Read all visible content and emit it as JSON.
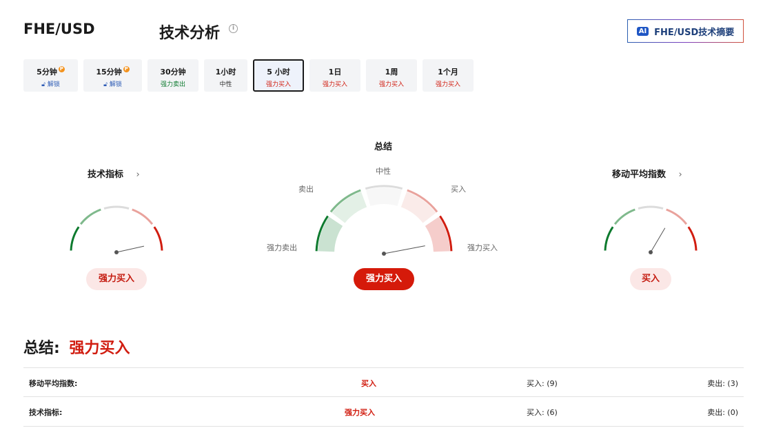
{
  "header": {
    "pair": "FHE/USD",
    "title": "技术分析",
    "info_icon": "info-circle-icon",
    "ai_badge": "AI",
    "ai_button": "FHE/USD技术摘要"
  },
  "tabs": [
    {
      "label": "5分钟",
      "sub": "解锁",
      "locked": true
    },
    {
      "label": "15分钟",
      "sub": "解锁",
      "locked": true
    },
    {
      "label": "30分钟",
      "sub": "强力卖出",
      "locked": false
    },
    {
      "label": "1小时",
      "sub": "中性",
      "locked": false
    },
    {
      "label": "5 小时",
      "sub": "强力买入",
      "locked": false,
      "active": true
    },
    {
      "label": "1日",
      "sub": "强力买入",
      "locked": false
    },
    {
      "label": "1周",
      "sub": "强力买入",
      "locked": false
    },
    {
      "label": "1个月",
      "sub": "强力买入",
      "locked": false
    }
  ],
  "gauges": {
    "technical": {
      "title": "技术指标",
      "result": "强力买入",
      "level": 0.93
    },
    "summary": {
      "title": "总结",
      "labels": {
        "neutral": "中性",
        "sell": "卖出",
        "buy": "买入",
        "strong_sell": "强力卖出",
        "strong_buy": "强力买入"
      },
      "result": "强力买入",
      "level": 0.94
    },
    "moving_avg": {
      "title": "移动平均指数",
      "result": "买入",
      "level": 0.67
    }
  },
  "summary": {
    "label": "总结:",
    "value": "强力买入",
    "rows": [
      {
        "name": "移动平均指数:",
        "action": "买入",
        "buy": "买入: (9)",
        "sell": "卖出: (3)"
      },
      {
        "name": "技术指标:",
        "action": "强力买入",
        "buy": "买入: (6)",
        "sell": "卖出: (0)"
      }
    ]
  },
  "colors": {
    "strong_sell": "#0d7a2e",
    "sell": "#7fb98c",
    "neutral": "#dcdcdc",
    "buy": "#e9a29c",
    "strong_buy": "#d11d10"
  }
}
